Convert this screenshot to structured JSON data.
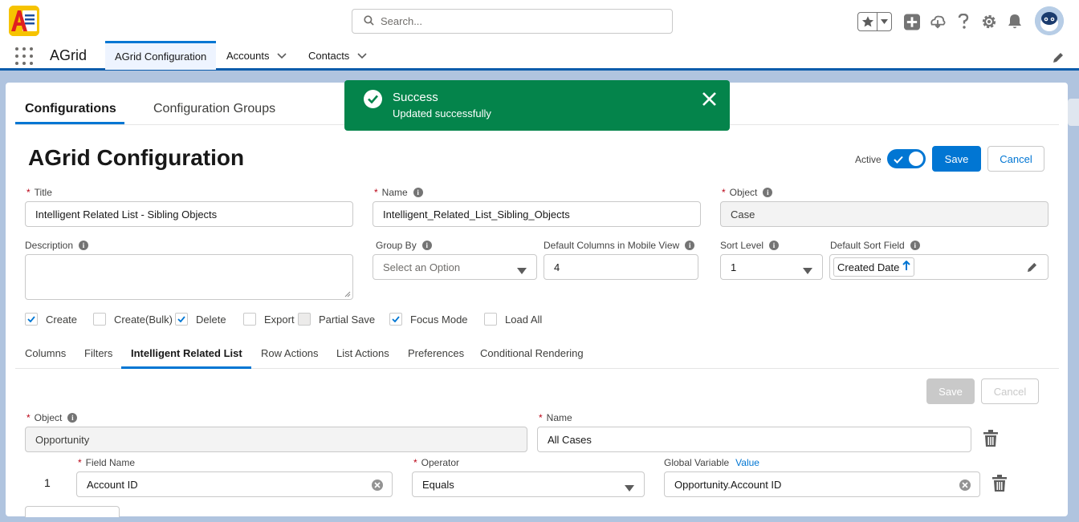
{
  "header": {
    "search_placeholder": "Search..."
  },
  "nav": {
    "app_name": "AGrid",
    "tabs": [
      {
        "label": "AGrid Configuration"
      },
      {
        "label": "Accounts"
      },
      {
        "label": "Contacts"
      }
    ]
  },
  "toast": {
    "title": "Success",
    "message": "Updated successfully"
  },
  "page": {
    "tabs": [
      "Configurations",
      "Configuration Groups"
    ],
    "title": "AGrid Configuration",
    "active_label": "Active",
    "save_label": "Save",
    "cancel_label": "Cancel"
  },
  "form": {
    "title_label": "Title",
    "title_value": "Intelligent Related List - Sibling Objects",
    "name_label": "Name",
    "name_value": "Intelligent_Related_List_Sibling_Objects",
    "object_label": "Object",
    "object_value": "Case",
    "description_label": "Description",
    "group_by_label": "Group By",
    "group_by_placeholder": "Select an Option",
    "mobile_cols_label": "Default Columns in Mobile View",
    "mobile_cols_value": "4",
    "sort_level_label": "Sort Level",
    "sort_level_value": "1",
    "sort_field_label": "Default Sort Field",
    "sort_field_value": "Created Date"
  },
  "checkboxes": [
    {
      "label": "Create",
      "checked": true
    },
    {
      "label": "Create(Bulk)",
      "checked": false
    },
    {
      "label": "Delete",
      "checked": true
    },
    {
      "label": "Export",
      "checked": false
    },
    {
      "label": "Partial Save",
      "checked": false
    },
    {
      "label": "Focus Mode",
      "checked": true
    },
    {
      "label": "Load All",
      "checked": false
    }
  ],
  "subtabs": [
    "Columns",
    "Filters",
    "Intelligent Related List",
    "Row Actions",
    "List Actions",
    "Preferences",
    "Conditional Rendering"
  ],
  "irl": {
    "save_label": "Save",
    "cancel_label": "Cancel",
    "object_label": "Object",
    "object_value": "Opportunity",
    "name_label": "Name",
    "name_value": "All Cases",
    "row_number": "1",
    "field_name_label": "Field Name",
    "field_name_value": "Account ID",
    "operator_label": "Operator",
    "operator_value": "Equals",
    "global_variable_label": "Global Variable",
    "value_link": "Value",
    "global_variable_value": "Opportunity.Account ID"
  }
}
